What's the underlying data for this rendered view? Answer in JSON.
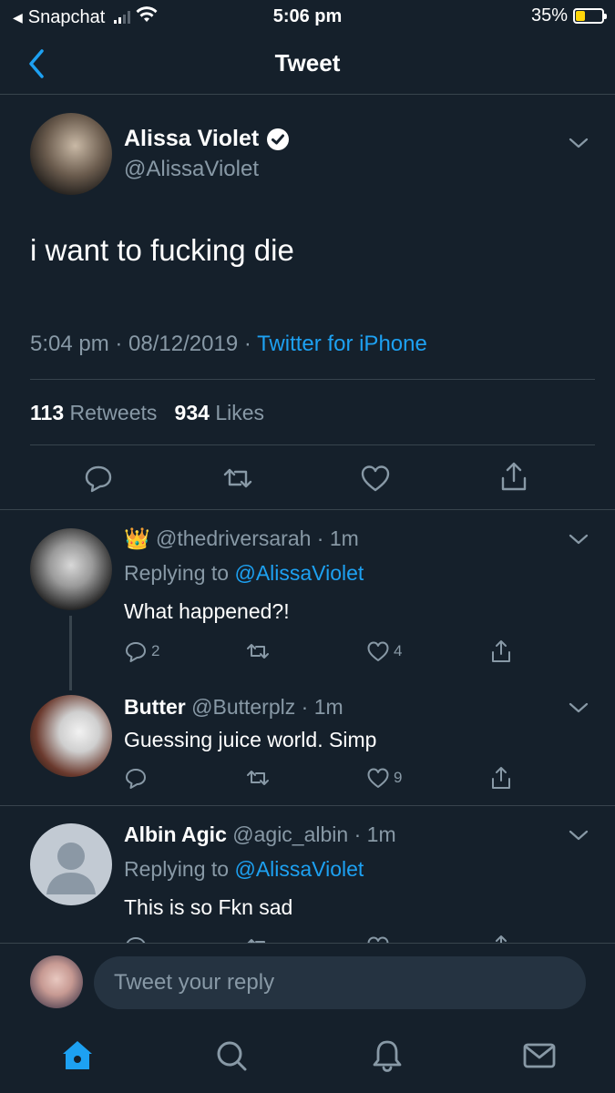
{
  "status_bar": {
    "back_app": "Snapchat",
    "time": "5:06 pm",
    "battery": "35%",
    "battery_level": 0.35
  },
  "nav": {
    "title": "Tweet",
    "back_icon": "chevron-left-icon"
  },
  "tweet": {
    "author_name": "Alissa Violet",
    "handle": "@AlissaViolet",
    "text": "i want to fucking die",
    "time": "5:04 pm",
    "date": "08/12/2019",
    "source": "Twitter for iPhone",
    "retweets_count": "113",
    "retweets_label": "Retweets",
    "likes_count": "934",
    "likes_label": "Likes"
  },
  "replies": [
    {
      "emoji": "👑",
      "name": "",
      "handle": "@thedriversarah",
      "time": "1m",
      "replying_label": "Replying to",
      "replying_to": "@AlissaViolet",
      "text": "What happened?!",
      "reply_count": "2",
      "retweet_count": "",
      "like_count": "4"
    },
    {
      "name": "Butter",
      "handle": "@Butterplz",
      "time": "1m",
      "text": "Guessing juice world.  Simp",
      "reply_count": "",
      "retweet_count": "",
      "like_count": "9"
    },
    {
      "name": "Albin Agic",
      "handle": "@agic_albin",
      "time": "1m",
      "replying_label": "Replying to",
      "replying_to": "@AlissaViolet",
      "text": "This is so Fkn sad"
    }
  ],
  "compose": {
    "placeholder": "Tweet your reply"
  },
  "tabs": [
    "home-icon",
    "search-icon",
    "notifications-bell-icon",
    "messages-envelope-icon"
  ],
  "colors": {
    "background": "#15202b",
    "accent": "#1da1f2",
    "muted": "#8899a6",
    "divider": "#38444d"
  }
}
